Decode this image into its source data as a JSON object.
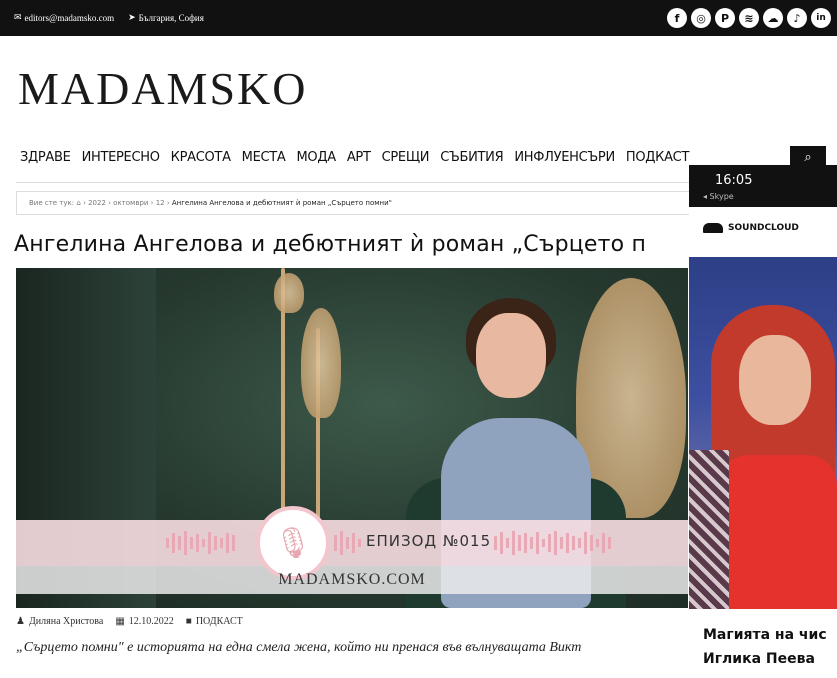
{
  "topbar": {
    "email": "editors@madamsko.com",
    "location": "България, София",
    "socials": [
      {
        "icon": "facebook-icon",
        "glyph": "f"
      },
      {
        "icon": "instagram-icon",
        "glyph": "◎"
      },
      {
        "icon": "pinterest-icon",
        "glyph": "P"
      },
      {
        "icon": "spotify-icon",
        "glyph": "≋"
      },
      {
        "icon": "soundcloud-icon",
        "glyph": "☁"
      },
      {
        "icon": "tiktok-icon",
        "glyph": "♪"
      },
      {
        "icon": "linkedin-icon",
        "glyph": "in"
      }
    ]
  },
  "logo": "MADAMSKO",
  "nav": {
    "items": [
      "ЗДРАВЕ",
      "ИНТЕРЕСНО",
      "КРАСОТА",
      "МЕСТА",
      "МОДА",
      "АРТ",
      "СРЕЩИ",
      "СЪБИТИЯ",
      "ИНФЛУЕНСЪРИ",
      "ПОДКАСТ"
    ],
    "search_glyph": "⌕"
  },
  "breadcrumb": {
    "prefix": "Вие сте тук:",
    "year": "2022",
    "month": "октомври",
    "day": "12",
    "current": "Ангелина Ангелова и дебютният ѝ роман „Сърцето помни\""
  },
  "article": {
    "title": "Ангелина Ангелова и дебютният ѝ роман „Сърцето п",
    "episode": "ЕПИЗОД №015",
    "site": "MADAMSKO.COM",
    "author": "Диляна Христова",
    "date": "12.10.2022",
    "category": "ПОДКАСТ",
    "excerpt": "„Сърцето помни\" е историята на една смела жена, който ни пренася във вълнуващата Викт"
  },
  "phone": {
    "time": "16:05",
    "back": "◂ Skype",
    "app": "SOUNDCLOUD",
    "title_line1": "Магията на чис",
    "title_line2": "Иглика Пеева"
  },
  "colors": {
    "topbar": "#111111",
    "banner_pink": "#f8dee2",
    "accent_pink": "#e9a9b4",
    "phone_shirt": "#e5322d"
  }
}
